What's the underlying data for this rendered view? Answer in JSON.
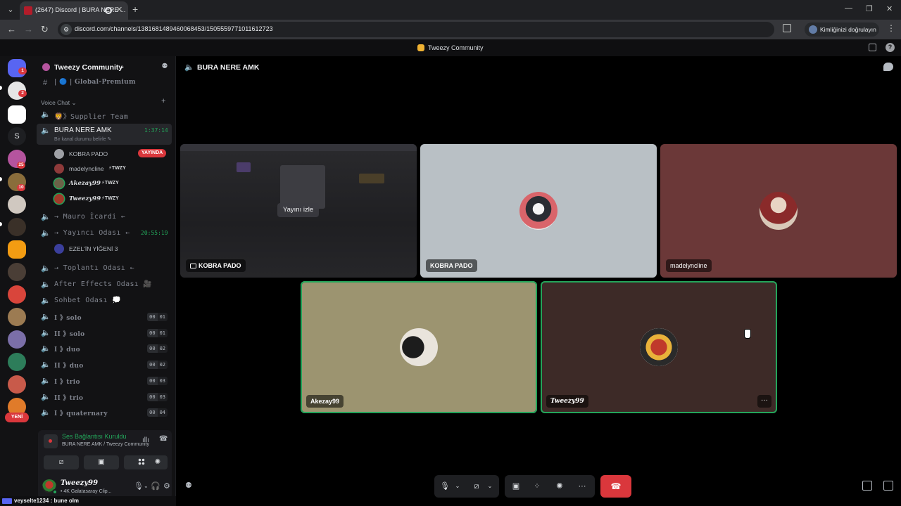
{
  "browser": {
    "tab_title": "(2647) Discord | BURA NERE ...",
    "url": "discord.com/channels/1381681489460068453/1505559771011612723",
    "profile_label": "Kimliğinizi doğrulayın"
  },
  "app": {
    "title": "Tweezy Community"
  },
  "rail": {
    "badges": [
      "1",
      "2",
      "25",
      "10"
    ],
    "new_label": "YENİ"
  },
  "sidebar": {
    "guild_name": "Tweezy Community",
    "top_channel": "| 🔵 | Global-Premium",
    "category": "Voice Chat ⌄",
    "channels": [
      {
        "label": "🦁》Supplier Team"
      },
      {
        "label": "BURA NERE AMK",
        "time": "1:37:14",
        "status": "Bir kanal durumu belirle ✎"
      },
      {
        "label": "→ Mauro İcardi ←"
      },
      {
        "label": "→ Yayıncı Odası ←",
        "time": "20:55:19"
      },
      {
        "label": "→ Toplantı Odası ←"
      },
      {
        "label": "After Effects Odası 🎥"
      },
      {
        "label": "Sohbet Odası 💭"
      }
    ],
    "voice_users": [
      {
        "name": "KOBRA PADO",
        "badge": "YAYINDA"
      },
      {
        "name": "madelyncline",
        "tag": "⚡TWZY"
      },
      {
        "name": "Akezay99",
        "tag": "⚡TWZY"
      },
      {
        "name": "Tweezy99",
        "tag": "⚡TWZY"
      }
    ],
    "yayinci_user": "EZEL'İN YİĞENİ 3",
    "room_channels": [
      {
        "label": "I 》solo",
        "c1": "00",
        "c2": "01"
      },
      {
        "label": "II 》solo",
        "c1": "00",
        "c2": "01"
      },
      {
        "label": "I 》duo",
        "c1": "00",
        "c2": "02"
      },
      {
        "label": "II 》duo",
        "c1": "00",
        "c2": "02"
      },
      {
        "label": "I 》trio",
        "c1": "00",
        "c2": "03"
      },
      {
        "label": "II 》trio",
        "c1": "00",
        "c2": "03"
      },
      {
        "label": "I 》quaternary",
        "c1": "00",
        "c2": "04"
      }
    ]
  },
  "voice_panel": {
    "title": "Ses Bağlantısı Kuruldu",
    "subtitle": "BURA NERE AMK / Tweezy Community"
  },
  "user_panel": {
    "name": "Tweezy99",
    "status": "• 4K Galatasaray Clip..."
  },
  "ticker": {
    "text": "veyselte1234 : bune olm"
  },
  "stage": {
    "channel_title": "BURA NERE AMK",
    "watch_label": "Yayını izle",
    "tiles": [
      {
        "label": "KOBRA PADO",
        "kind": "stream"
      },
      {
        "label": "KOBRA PADO",
        "kind": "camera"
      },
      {
        "label": "madelyncline",
        "kind": "camera"
      },
      {
        "label": "Akezay99",
        "kind": "camera"
      },
      {
        "label": "Tweezy99",
        "kind": "camera"
      }
    ]
  },
  "colors": {
    "accent_green": "#23a55a",
    "danger_red": "#da373c",
    "tile_grey": "#b9c0c5",
    "tile_maroon": "#6b3838",
    "tile_olive": "#9c9470",
    "tile_brown": "#3d2a27"
  }
}
